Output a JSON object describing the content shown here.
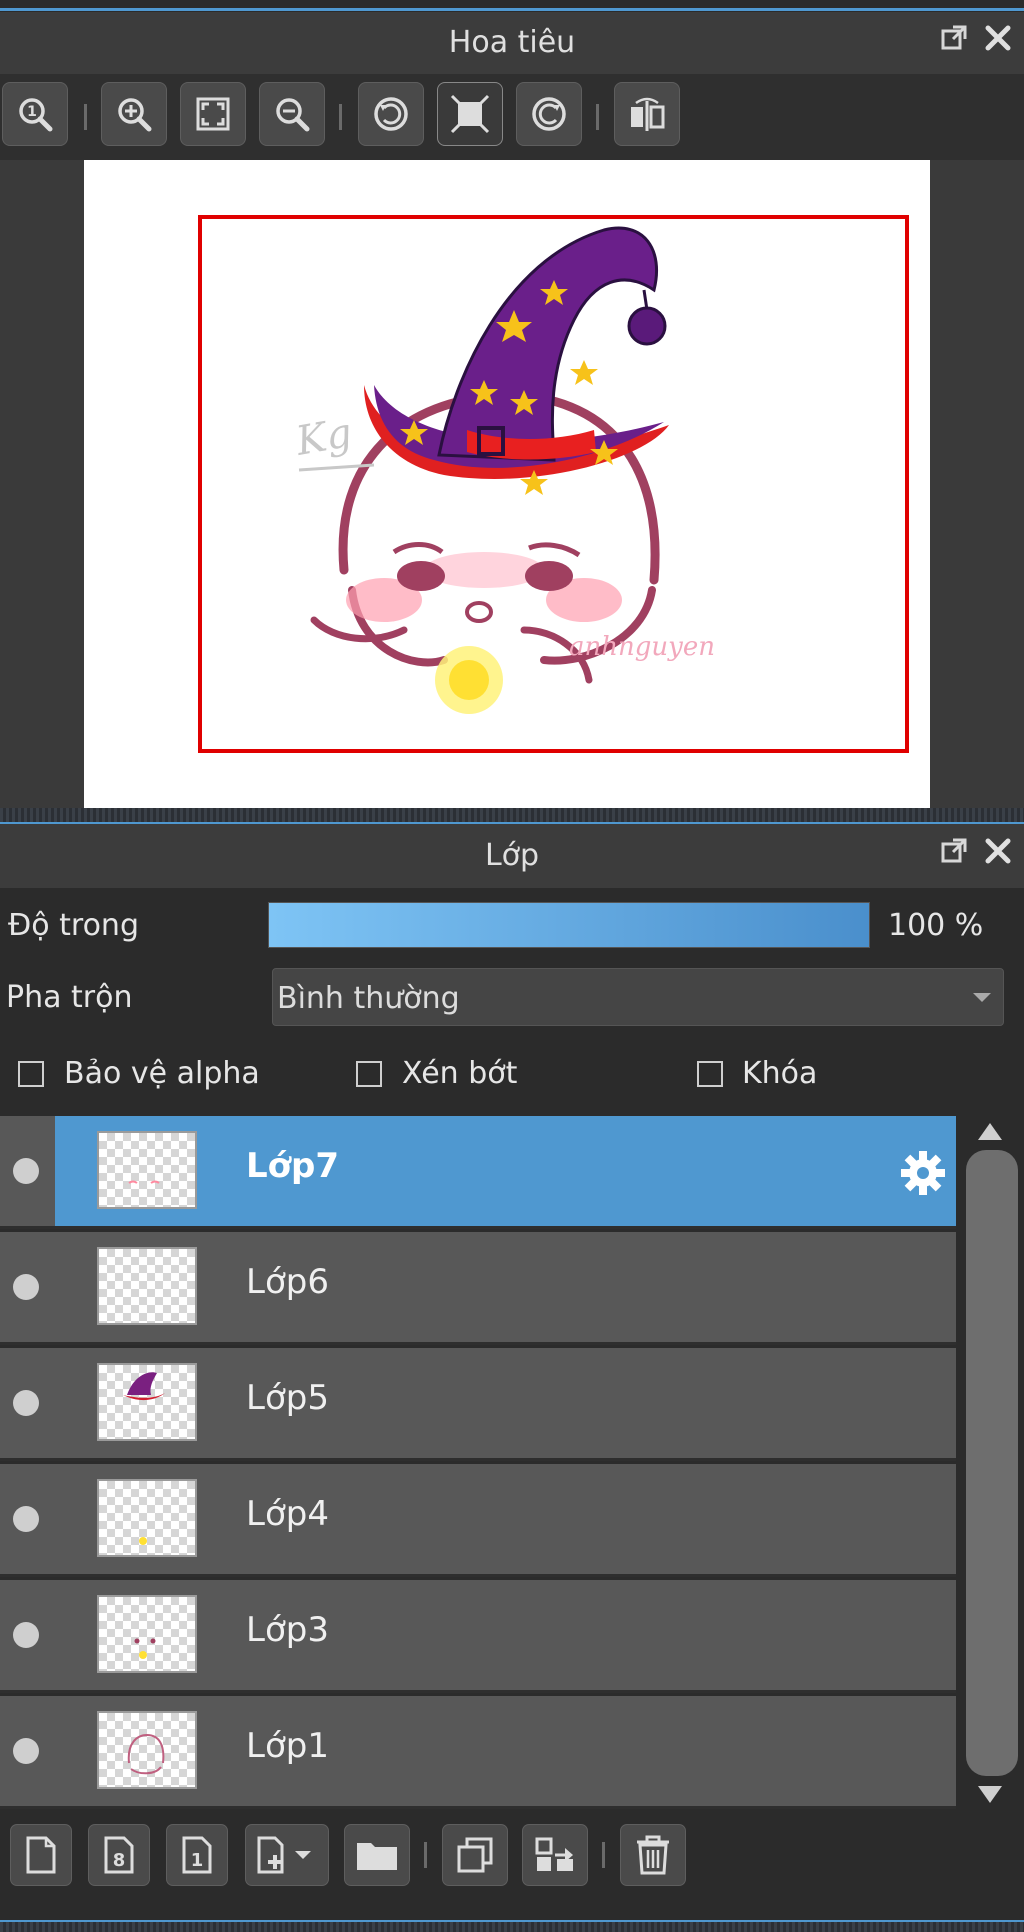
{
  "navigator": {
    "title": "Hoa tiêu",
    "toolbar": [
      {
        "icon": "zoom-actual-size-icon"
      },
      {
        "icon": "zoom-in-icon"
      },
      {
        "icon": "fit-to-window-icon"
      },
      {
        "icon": "zoom-out-icon"
      },
      {
        "icon": "rotate-left-icon"
      },
      {
        "icon": "reset-view-icon"
      },
      {
        "icon": "rotate-right-icon"
      },
      {
        "icon": "flip-horizontal-icon"
      }
    ],
    "preview_watermark": "Kg",
    "preview_signature": "anhnguyen"
  },
  "layers_panel": {
    "title": "Lớp",
    "opacity_label": "Độ trong",
    "opacity_value": "100 %",
    "opacity_fraction": 1.0,
    "blend_label": "Pha trộn",
    "blend_value": "Bình thường",
    "checkboxes": {
      "alpha_protect": "Bảo vệ alpha",
      "clipping": "Xén bớt",
      "lock": "Khóa"
    },
    "layers": [
      {
        "name": "Lớp7",
        "selected": true
      },
      {
        "name": "Lớp6",
        "selected": false
      },
      {
        "name": "Lớp5",
        "selected": false
      },
      {
        "name": "Lớp4",
        "selected": false
      },
      {
        "name": "Lớp3",
        "selected": false
      },
      {
        "name": "Lớp1",
        "selected": false
      }
    ],
    "bottom_toolbar": [
      {
        "icon": "new-layer-icon"
      },
      {
        "icon": "new-8bit-layer-icon"
      },
      {
        "icon": "new-1bit-layer-icon"
      },
      {
        "icon": "add-layer-menu-icon"
      },
      {
        "icon": "folder-icon"
      },
      {
        "icon": "duplicate-layer-icon"
      },
      {
        "icon": "merge-down-icon"
      },
      {
        "icon": "delete-layer-icon"
      }
    ]
  },
  "colors": {
    "accent": "#4f98d0",
    "frame": "#e00000"
  }
}
